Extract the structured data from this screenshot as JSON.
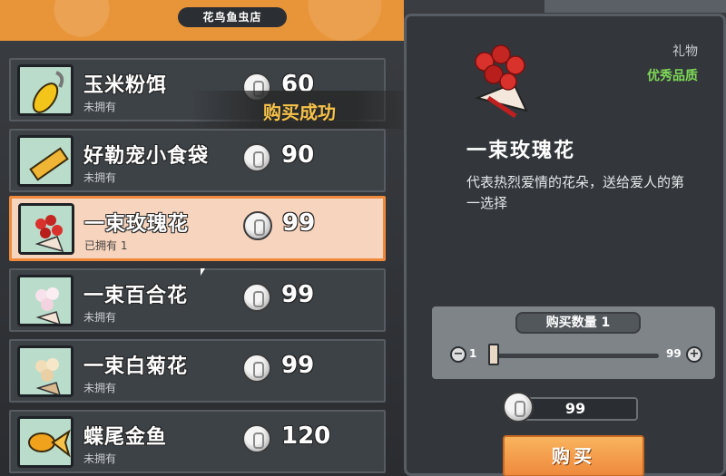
{
  "shop": {
    "title": "花鸟鱼虫店"
  },
  "toast": {
    "text": "购买成功"
  },
  "items": [
    {
      "name": "玉米粉饵",
      "owned": "未拥有",
      "price": "60",
      "icon": "corn-bait-icon",
      "selected": false
    },
    {
      "name": "好勒宠小食袋",
      "owned": "未拥有",
      "price": "90",
      "icon": "snack-bag-icon",
      "selected": false
    },
    {
      "name": "一束玫瑰花",
      "owned": "已拥有 1",
      "price": "99",
      "icon": "rose-bouquet-icon",
      "selected": true
    },
    {
      "name": "一束百合花",
      "owned": "未拥有",
      "price": "99",
      "icon": "lily-bouquet-icon",
      "selected": false
    },
    {
      "name": "一束白菊花",
      "owned": "未拥有",
      "price": "99",
      "icon": "chrysanthemum-bouquet-icon",
      "selected": false
    },
    {
      "name": "蝶尾金鱼",
      "owned": "未拥有",
      "price": "120",
      "icon": "goldfish-icon",
      "selected": false
    }
  ],
  "detail": {
    "category": "礼物",
    "quality": "优秀品质",
    "name": "一束玫瑰花",
    "description": "代表热烈爱情的花朵，送给爱人的第一选择",
    "quantity_label": "购买数量 1",
    "qty_min": "1",
    "qty_max": "99",
    "quantity_fraction": 0.0,
    "total_cost": "99",
    "buy_label": "购买"
  },
  "colors": {
    "accent": "#ef8a3d",
    "quality_green": "#7ed957",
    "selected_bg": "#f7d4bd"
  }
}
